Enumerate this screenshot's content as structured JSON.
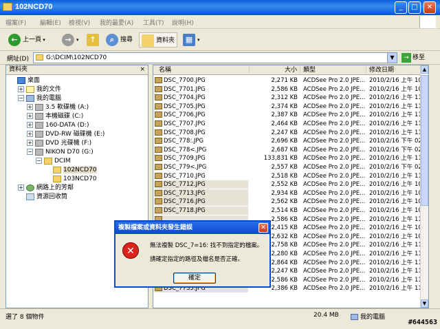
{
  "window": {
    "title": "102NCD70"
  },
  "title_buttons": {
    "min": "_",
    "max": "□",
    "close": "✕"
  },
  "menu": [
    "檔案(F)",
    "編輯(E)",
    "檢視(V)",
    "我的最愛(A)",
    "工具(T)",
    "說明(H)"
  ],
  "toolbar": {
    "back": "上一頁",
    "search": "搜尋",
    "folders": "資料夾"
  },
  "address": {
    "label": "網址(D)",
    "value": "G:\\DCIM\\102NCD70",
    "go": "移至"
  },
  "folderpane": {
    "header": "資料夾",
    "close": "×",
    "items": [
      {
        "label": "桌面",
        "icon": "desktop-icon",
        "indent": 0,
        "expander": ""
      },
      {
        "label": "我的文件",
        "icon": "documents-icon",
        "indent": 1,
        "expander": "+"
      },
      {
        "label": "我的電腦",
        "icon": "computer-icon",
        "indent": 1,
        "expander": "−"
      },
      {
        "label": "3.5 軟碟機 (A:)",
        "icon": "floppy-icon",
        "indent": 2,
        "expander": "+"
      },
      {
        "label": "本機磁碟 (C:)",
        "icon": "drive-icon",
        "indent": 2,
        "expander": "+"
      },
      {
        "label": "160-DATA (D:)",
        "icon": "drive-icon",
        "indent": 2,
        "expander": "+"
      },
      {
        "label": "DVD-RW 磁碟機 (E:)",
        "icon": "dvd-icon",
        "indent": 2,
        "expander": "+"
      },
      {
        "label": "DVD 光碟機 (F:)",
        "icon": "dvd-icon",
        "indent": 2,
        "expander": "+"
      },
      {
        "label": "NIKON D70 (G:)",
        "icon": "drive-icon",
        "indent": 2,
        "expander": "−"
      },
      {
        "label": "DCIM",
        "icon": "folder-icon",
        "indent": 3,
        "expander": "−"
      },
      {
        "label": "102NCD70",
        "icon": "folder-icon",
        "indent": 4,
        "expander": "",
        "selected": true
      },
      {
        "label": "103NCD70",
        "icon": "folder-icon",
        "indent": 4,
        "expander": ""
      },
      {
        "label": "網路上的芳鄰",
        "icon": "network-icon",
        "indent": 1,
        "expander": "+"
      },
      {
        "label": "資源回收筒",
        "icon": "recycle-bin-icon",
        "indent": 1,
        "expander": ""
      }
    ]
  },
  "columns": {
    "name": "名稱",
    "size": "大小",
    "type": "類型",
    "date": "修改日期"
  },
  "files": [
    {
      "name": "DSC_7700.JPG",
      "size": "2,271 KB",
      "type": "ACDSee Pro 2.0 JPE...",
      "date": "2010/2/16 上午 10:1"
    },
    {
      "name": "DSC_7701.JPG",
      "size": "2,586 KB",
      "type": "ACDSee Pro 2.0 JPE...",
      "date": "2010/2/16 上午 10:1"
    },
    {
      "name": "DSC_7704.JPG",
      "size": "2,312 KB",
      "type": "ACDSee Pro 2.0 JPE...",
      "date": "2010/2/16 上午 11:2"
    },
    {
      "name": "DSC_7705.JPG",
      "size": "2,374 KB",
      "type": "ACDSee Pro 2.0 JPE...",
      "date": "2010/2/16 上午 11:2"
    },
    {
      "name": "DSC_7706.JPG",
      "size": "2,387 KB",
      "type": "ACDSee Pro 2.0 JPE...",
      "date": "2010/2/16 上午 11:2"
    },
    {
      "name": "DSC_7707.JPG",
      "size": "2,464 KB",
      "type": "ACDSee Pro 2.0 JPE...",
      "date": "2010/2/16 上午 11:2"
    },
    {
      "name": "DSC_7708.JPG",
      "size": "2,247 KB",
      "type": "ACDSee Pro 2.0 JPE...",
      "date": "2010/2/16 上午 11:2"
    },
    {
      "name": "DSC_778:.JPG",
      "size": "2,696 KB",
      "type": "ACDSee Pro 2.0 JPE...",
      "date": "2010/2/16 下午 02:3"
    },
    {
      "name": "DSC_778<.JPG",
      "size": "2,687 KB",
      "type": "ACDSee Pro 2.0 JPE...",
      "date": "2010/2/16 下午 02:3"
    },
    {
      "name": "DSC_7709.JPG",
      "size": "133,831 KB",
      "type": "ACDSee Pro 2.0 JPE...",
      "date": "2010/2/16 上午 11:2"
    },
    {
      "name": "DSC_779<.JPG",
      "size": "2,557 KB",
      "type": "ACDSee Pro 2.0 JPE...",
      "date": "2010/2/16 下午 02:3"
    },
    {
      "name": "DSC_7710.JPG",
      "size": "2,518 KB",
      "type": "ACDSee Pro 2.0 JPE...",
      "date": "2010/2/16 上午 11:2"
    },
    {
      "name": "DSC_7712.JPG",
      "size": "2,552 KB",
      "type": "ACDSee Pro 2.0 JPE...",
      "date": "2010/2/16 上午 10:3"
    },
    {
      "name": "DSC_7713.JPG",
      "size": "2,934 KB",
      "type": "ACDSee Pro 2.0 JPE...",
      "date": "2010/2/16 上午 10:3"
    },
    {
      "name": "DSC_7716.JPG",
      "size": "2,562 KB",
      "type": "ACDSee Pro 2.0 JPE...",
      "date": "2010/2/16 上午 10:4"
    },
    {
      "name": "DSC_7718.JPG",
      "size": "2,514 KB",
      "type": "ACDSee Pro 2.0 JPE...",
      "date": "2010/2/16 上午 10:4"
    },
    {
      "name": "",
      "size": "2,586 KB",
      "type": "ACDSee Pro 2.0 JPE...",
      "date": "2010/2/16 上午 11:4"
    },
    {
      "name": "",
      "size": "2,415 KB",
      "type": "ACDSee Pro 2.0 JPE...",
      "date": "2010/2/16 上午 10:4"
    },
    {
      "name": "",
      "size": "2,632 KB",
      "type": "ACDSee Pro 2.0 JPE...",
      "date": "2010/2/16 上午 10:4"
    },
    {
      "name": "",
      "size": "2,758 KB",
      "type": "ACDSee Pro 2.0 JPE...",
      "date": "2010/2/16 上午 11:1"
    },
    {
      "name": "",
      "size": "2,280 KB",
      "type": "ACDSee Pro 2.0 JPE...",
      "date": "2010/2/16 上午 11:1"
    },
    {
      "name": "",
      "size": "2,864 KB",
      "type": "ACDSee Pro 2.0 JPE...",
      "date": "2010/2/16 上午 11:1"
    },
    {
      "name": "",
      "size": "2,247 KB",
      "type": "ACDSee Pro 2.0 JPE...",
      "date": "2010/2/16 上午 11:1"
    },
    {
      "name": "",
      "size": "2,586 KB",
      "type": "ACDSee Pro 2.0 JPE...",
      "date": "2010/2/16 上午 11:1"
    },
    {
      "name": "DSC_7735.JPG",
      "size": "2,386 KB",
      "type": "ACDSee Pro 2.0 JPE...",
      "date": "2010/2/16 上午 11:1"
    }
  ],
  "status": {
    "left": "選了 8 個物件",
    "size": "20.4 MB",
    "location": "我的電腦"
  },
  "dialog": {
    "title": "複製檔案或資料夾發生錯誤",
    "message1": "無法複製 DSC_7=16: 找不到指定的檔案。",
    "message2": "請確定指定的路徑及檔名是否正確。",
    "ok": "確定",
    "close": "✕",
    "icon": "✕"
  },
  "watermark": "#644563"
}
